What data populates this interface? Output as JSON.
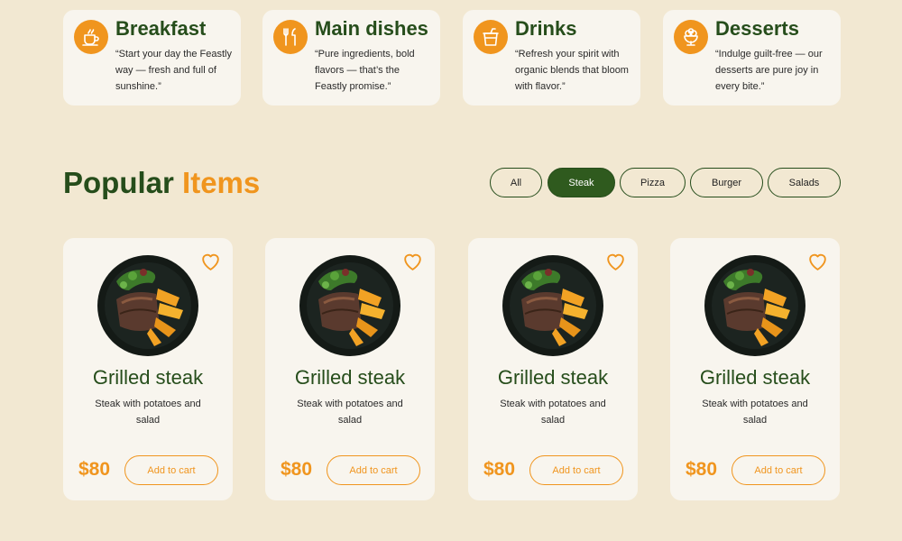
{
  "colors": {
    "background": "#f2e8d2",
    "card": "#f8f5ee",
    "brand_green": "#264d1b",
    "accent_orange": "#f0951e"
  },
  "categories": [
    {
      "icon": "breakfast-cup-icon",
      "title": "Breakfast",
      "description": "“Start your day the Feastly way — fresh and full of sunshine.”"
    },
    {
      "icon": "fork-knife-icon",
      "title": "Main dishes",
      "description": "“Pure ingredients, bold flavors — that’s the Feastly promise.”"
    },
    {
      "icon": "drink-cup-icon",
      "title": "Drinks",
      "description": "“Refresh your spirit with organic blends that bloom with flavor.”"
    },
    {
      "icon": "ice-cream-bowl-icon",
      "title": "Desserts",
      "description": "“Indulge guilt-free — our desserts are pure joy in every bite.”"
    }
  ],
  "section": {
    "title_main": "Popular",
    "title_accent": "Items"
  },
  "filters": [
    {
      "label": "All",
      "active": false
    },
    {
      "label": "Steak",
      "active": true
    },
    {
      "label": "Pizza",
      "active": false
    },
    {
      "label": "Burger",
      "active": false
    },
    {
      "label": "Salads",
      "active": false
    }
  ],
  "products": [
    {
      "name": "Grilled steak",
      "description": "Steak with potatoes and salad",
      "price": "$80",
      "button": "Add to cart",
      "favorite_icon": "heart-outline-icon"
    },
    {
      "name": "Grilled steak",
      "description": "Steak with potatoes and salad",
      "price": "$80",
      "button": "Add to cart",
      "favorite_icon": "heart-outline-icon"
    },
    {
      "name": "Grilled steak",
      "description": "Steak with potatoes and salad",
      "price": "$80",
      "button": "Add to cart",
      "favorite_icon": "heart-outline-icon"
    },
    {
      "name": "Grilled steak",
      "description": "Steak with potatoes and salad",
      "price": "$80",
      "button": "Add to cart",
      "favorite_icon": "heart-outline-icon"
    }
  ]
}
